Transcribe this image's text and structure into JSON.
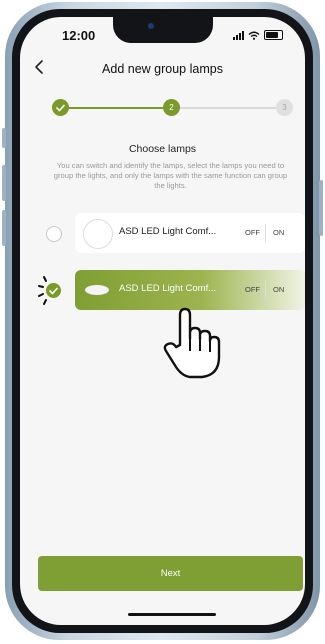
{
  "status_bar": {
    "time": "12:00"
  },
  "header": {
    "title": "Add new group lamps"
  },
  "stepper": {
    "step2": "2",
    "step3": "3"
  },
  "section": {
    "subtitle": "Choose lamps",
    "description": "You can switch and identify the lamps, select the lamps you need to group the lights, and only the lamps with the same function can group the lights."
  },
  "lamps": [
    {
      "name": "ASD LED Light Comf...",
      "off": "OFF",
      "on": "ON",
      "selected": false
    },
    {
      "name": "ASD LED Light Comf...",
      "off": "OFF",
      "on": "ON",
      "selected": true
    }
  ],
  "footer": {
    "next_label": "Next"
  },
  "colors": {
    "accent": "#7a9a2a",
    "accent_light": "#9cb44f"
  },
  "icons": [
    "back-chevron-icon",
    "check-icon",
    "pointer-hand-icon",
    "signal-icon",
    "wifi-icon",
    "battery-icon"
  ]
}
